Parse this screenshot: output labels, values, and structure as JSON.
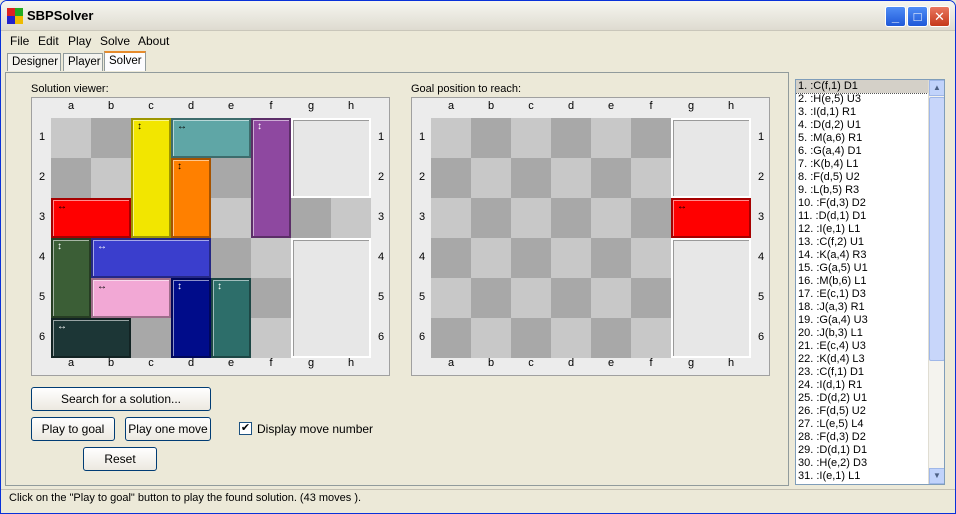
{
  "window": {
    "title": "SBPSolver"
  },
  "menu": [
    "File",
    "Edit",
    "Play",
    "Solve",
    "About"
  ],
  "tabs": [
    "Designer",
    "Player",
    "Solver"
  ],
  "solution_viewer": {
    "label": "Solution viewer:",
    "cols": [
      "a",
      "b",
      "c",
      "d",
      "e",
      "f",
      "g",
      "h"
    ],
    "rows": [
      "1",
      "2",
      "3",
      "4",
      "5",
      "6"
    ],
    "pieces": [
      {
        "id": "C",
        "color": "#f2e600",
        "dir": "vertical"
      },
      {
        "id": "D",
        "color": "#5fa6a6",
        "dir": "horizontal"
      },
      {
        "id": "H",
        "color": "#8e48a0",
        "dir": "vertical"
      },
      {
        "id": "F",
        "color": "#ff8000",
        "dir": "vertical"
      },
      {
        "id": "A",
        "color": "#ff0000",
        "dir": "horizontal"
      },
      {
        "id": "G",
        "color": "#3b5e36",
        "dir": "vertical"
      },
      {
        "id": "K",
        "color": "#3a3ecd",
        "dir": "horizontal"
      },
      {
        "id": "L",
        "color": "#f2a8d5",
        "dir": "horizontal"
      },
      {
        "id": "I",
        "color": "#000c8a",
        "dir": "vertical"
      },
      {
        "id": "E",
        "color": "#2d6e6a",
        "dir": "vertical"
      },
      {
        "id": "J",
        "color": "#1c3636",
        "dir": "horizontal"
      }
    ]
  },
  "goal_position": {
    "label": "Goal position to reach:",
    "cols": [
      "a",
      "b",
      "c",
      "d",
      "e",
      "f",
      "g",
      "h"
    ],
    "rows": [
      "1",
      "2",
      "3",
      "4",
      "5",
      "6"
    ],
    "target": {
      "color": "#ff0000",
      "dir": "horizontal"
    }
  },
  "buttons": {
    "search": "Search for a solution...",
    "play_to_goal": "Play to goal",
    "play_one_move": "Play one move",
    "reset": "Reset"
  },
  "display_move_number": {
    "label": "Display move number",
    "checked": true
  },
  "moves": [
    "1. :C(f,1) D1",
    "2. :H(e,5) U3",
    "3. :I(d,1) R1",
    "4. :D(d,2) U1",
    "5. :M(a,6) R1",
    "6. :G(a,4) D1",
    "7. :K(b,4) L1",
    "8. :F(d,5) U2",
    "9. :L(b,5) R3",
    "10. :F(d,3) D2",
    "11. :D(d,1) D1",
    "12. :I(e,1) L1",
    "13. :C(f,2) U1",
    "14. :K(a,4) R3",
    "15. :G(a,5) U1",
    "16. :M(b,6) L1",
    "17. :E(c,1) D3",
    "18. :J(a,3) R1",
    "19. :G(a,4) U3",
    "20. :J(b,3) L1",
    "21. :E(c,4) U3",
    "22. :K(d,4) L3",
    "23. :C(f,1) D1",
    "24. :I(d,1) R1",
    "25. :D(d,2) U1",
    "26. :F(d,5) U2",
    "27. :L(e,5) L4",
    "28. :F(d,3) D2",
    "29. :D(d,1) D1",
    "30. :H(e,2) D3",
    "31. :I(e,1) L1"
  ],
  "status": "Click on the \"Play to goal\" button to play the found solution. (43 moves )."
}
